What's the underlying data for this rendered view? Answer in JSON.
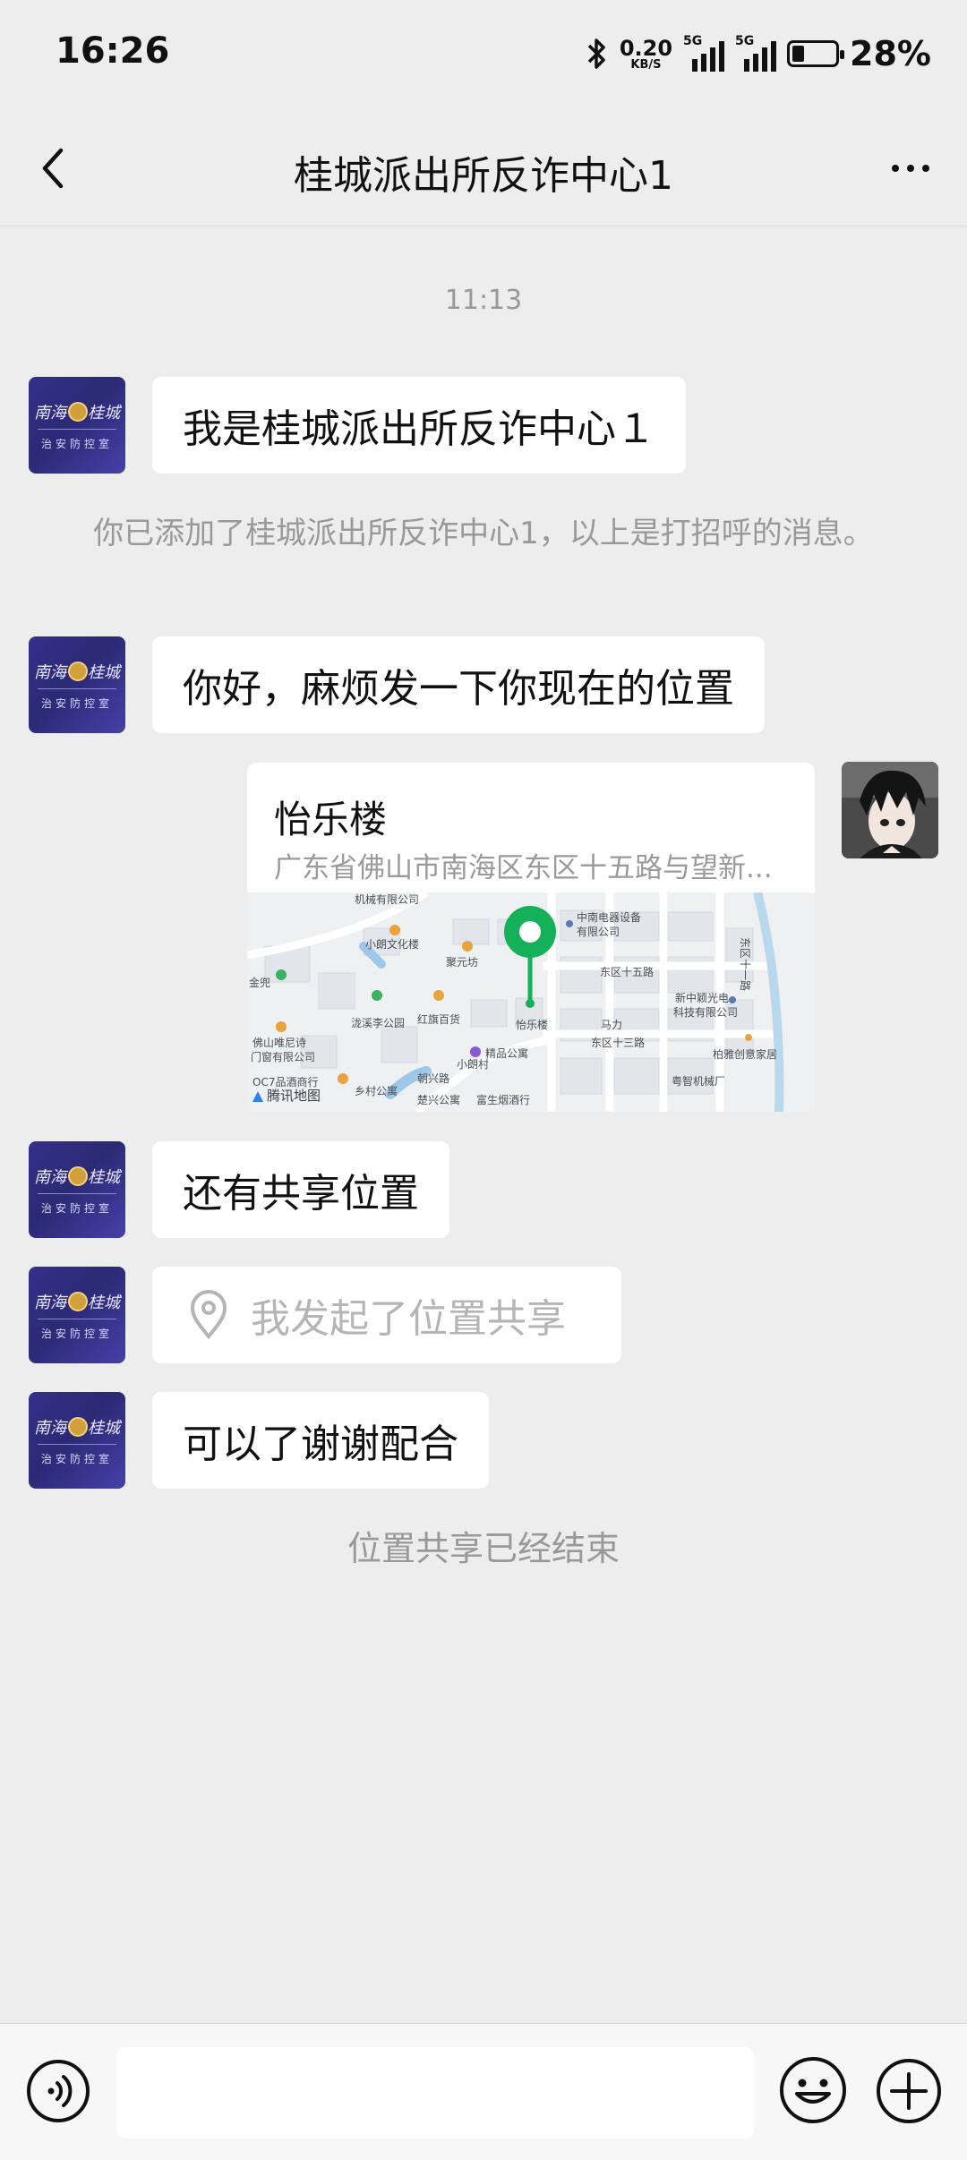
{
  "status_bar": {
    "time": "16:26",
    "net_speed_value": "0.20",
    "net_speed_unit": "KB/S",
    "signal_1_type": "5G",
    "signal_2_type": "5G",
    "battery_percent": "28%",
    "battery_level": 0.28
  },
  "header": {
    "title": "桂城派出所反诈中心1",
    "back_icon": "chevron-left-icon",
    "more_icon": "more-dots-icon"
  },
  "chat": {
    "timestamp": "11:13",
    "messages": [
      {
        "text": "我是桂城派出所反诈中心１"
      },
      {
        "text": "你好，麻烦发一下你现在的位置"
      },
      {
        "text": "还有共享位置"
      },
      {
        "text": "我发起了位置共享"
      },
      {
        "text": "可以了谢谢配合"
      }
    ],
    "system_added": "你已添加了桂城派出所反诈中心1，以上是打招呼的消息。",
    "system_share_ended": "位置共享已经结束",
    "contact_avatar_text_top_left": "南海",
    "contact_avatar_text_top_right": "桂城",
    "contact_avatar_text_bottom": "治安防控室",
    "location_card": {
      "name": "怡乐楼",
      "address": "广东省佛山市南海区东区十五路与望新...",
      "map_labels": [
        "机械有限公司",
        "中南电器设备",
        "有限公司",
        "小朗文化楼",
        "聚元坊",
        "东区十五路",
        "新中颖光电",
        "科技有限公司",
        "金兜",
        "泷溪李公园",
        "红旗百货",
        "怡乐楼",
        "马力",
        "东区十三路",
        "佛山唯尼诗",
        "门窗有限公司",
        "精品公寓",
        "柏雅创意家居",
        "小朗村",
        "粤智机械厂",
        "OC7品酒商行",
        "腾讯地图",
        "乡村公寓",
        "楚兴公寓",
        "富生烟酒行",
        "东区十一路",
        "朝兴路"
      ]
    }
  },
  "bottom_bar": {
    "voice_icon": "voice-icon",
    "emoji_icon": "emoji-icon",
    "plus_icon": "plus-icon",
    "input_value": ""
  }
}
